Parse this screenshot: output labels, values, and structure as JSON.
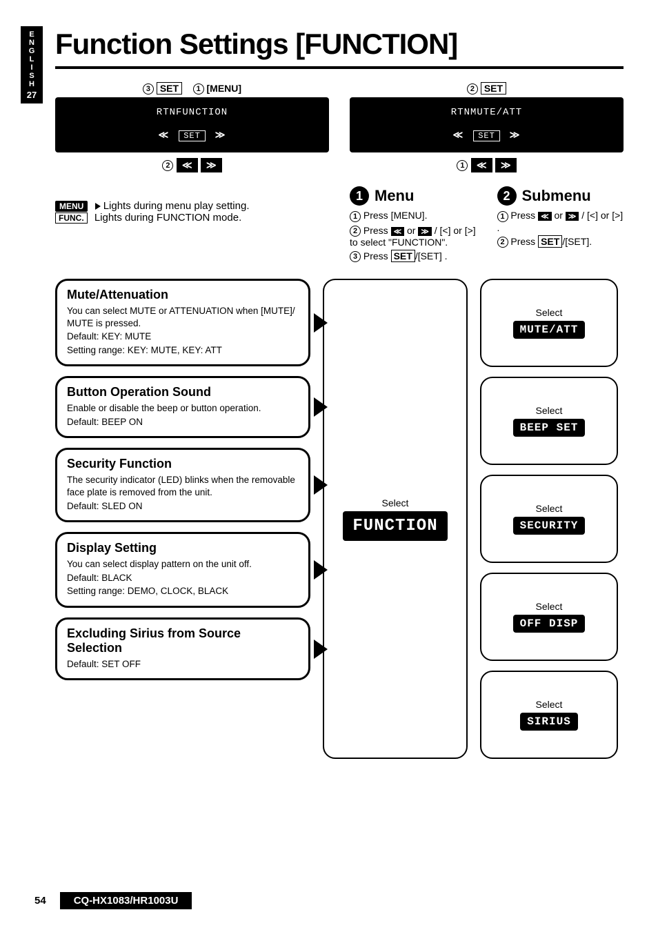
{
  "sidebar": {
    "lang": "ENGLISH",
    "page_side": "27"
  },
  "title": "Function Settings [FUNCTION]",
  "device_left": {
    "callout_set": "SET",
    "callout_menu": "[MENU]",
    "lcd": "RTNFUNCTION",
    "set_label": "SET"
  },
  "device_right": {
    "callout_set": "SET",
    "lcd": "RTNMUTE/ATT",
    "set_label": "SET"
  },
  "lights": {
    "menu_label": "MENU",
    "menu_text": "Lights during menu play setting.",
    "func_label": "FUNC.",
    "func_text": "Lights during FUNCTION mode."
  },
  "menu": {
    "heading": "Menu",
    "step1": "Press [MENU].",
    "step2a": "Press ",
    "step2b": " / [<] or [>] to select \"FUNCTION\".",
    "step3a": "Press ",
    "step3_set1": "SET",
    "step3b": "/[SET] ."
  },
  "submenu": {
    "heading": "Submenu",
    "step1a": "Press ",
    "step1b": " / [<] or [>] .",
    "step2a": "Press ",
    "step2_set1": "SET",
    "step2b": "/[SET]."
  },
  "settings": [
    {
      "title": "Mute/Attenuation",
      "body": "You can select MUTE or ATTENUATION when [MUTE]/ MUTE is pressed.",
      "default": "Default: KEY: MUTE",
      "range": "Setting range: KEY: MUTE, KEY: ATT"
    },
    {
      "title": "Button Operation Sound",
      "body": "Enable or disable the beep or button operation.",
      "default": "Default: BEEP ON",
      "range": ""
    },
    {
      "title": "Security Function",
      "body": "The security indicator (LED) blinks when the removable face plate is removed from the unit.",
      "default": "Default: SLED ON",
      "range": ""
    },
    {
      "title": "Display Setting",
      "body": "You can select display pattern on the unit off.",
      "default": "Default: BLACK",
      "range": "Setting range: DEMO, CLOCK, BLACK"
    },
    {
      "title": "Excluding Sirius from Source Selection",
      "body": "",
      "default": "Default: SET OFF",
      "range": ""
    }
  ],
  "mid": {
    "select": "Select",
    "chip": "FUNCTION"
  },
  "submenu_chips": [
    {
      "select": "Select",
      "chip": "MUTE/ATT"
    },
    {
      "select": "Select",
      "chip": "BEEP SET"
    },
    {
      "select": "Select",
      "chip": "SECURITY"
    },
    {
      "select": "Select",
      "chip": "OFF DISP"
    },
    {
      "select": "Select",
      "chip": "SIRIUS"
    }
  ],
  "footer": {
    "page": "54",
    "model": "CQ-HX1083/HR1003U"
  },
  "glyph": {
    "left": "≪",
    "right": "≫",
    "or": "or"
  }
}
